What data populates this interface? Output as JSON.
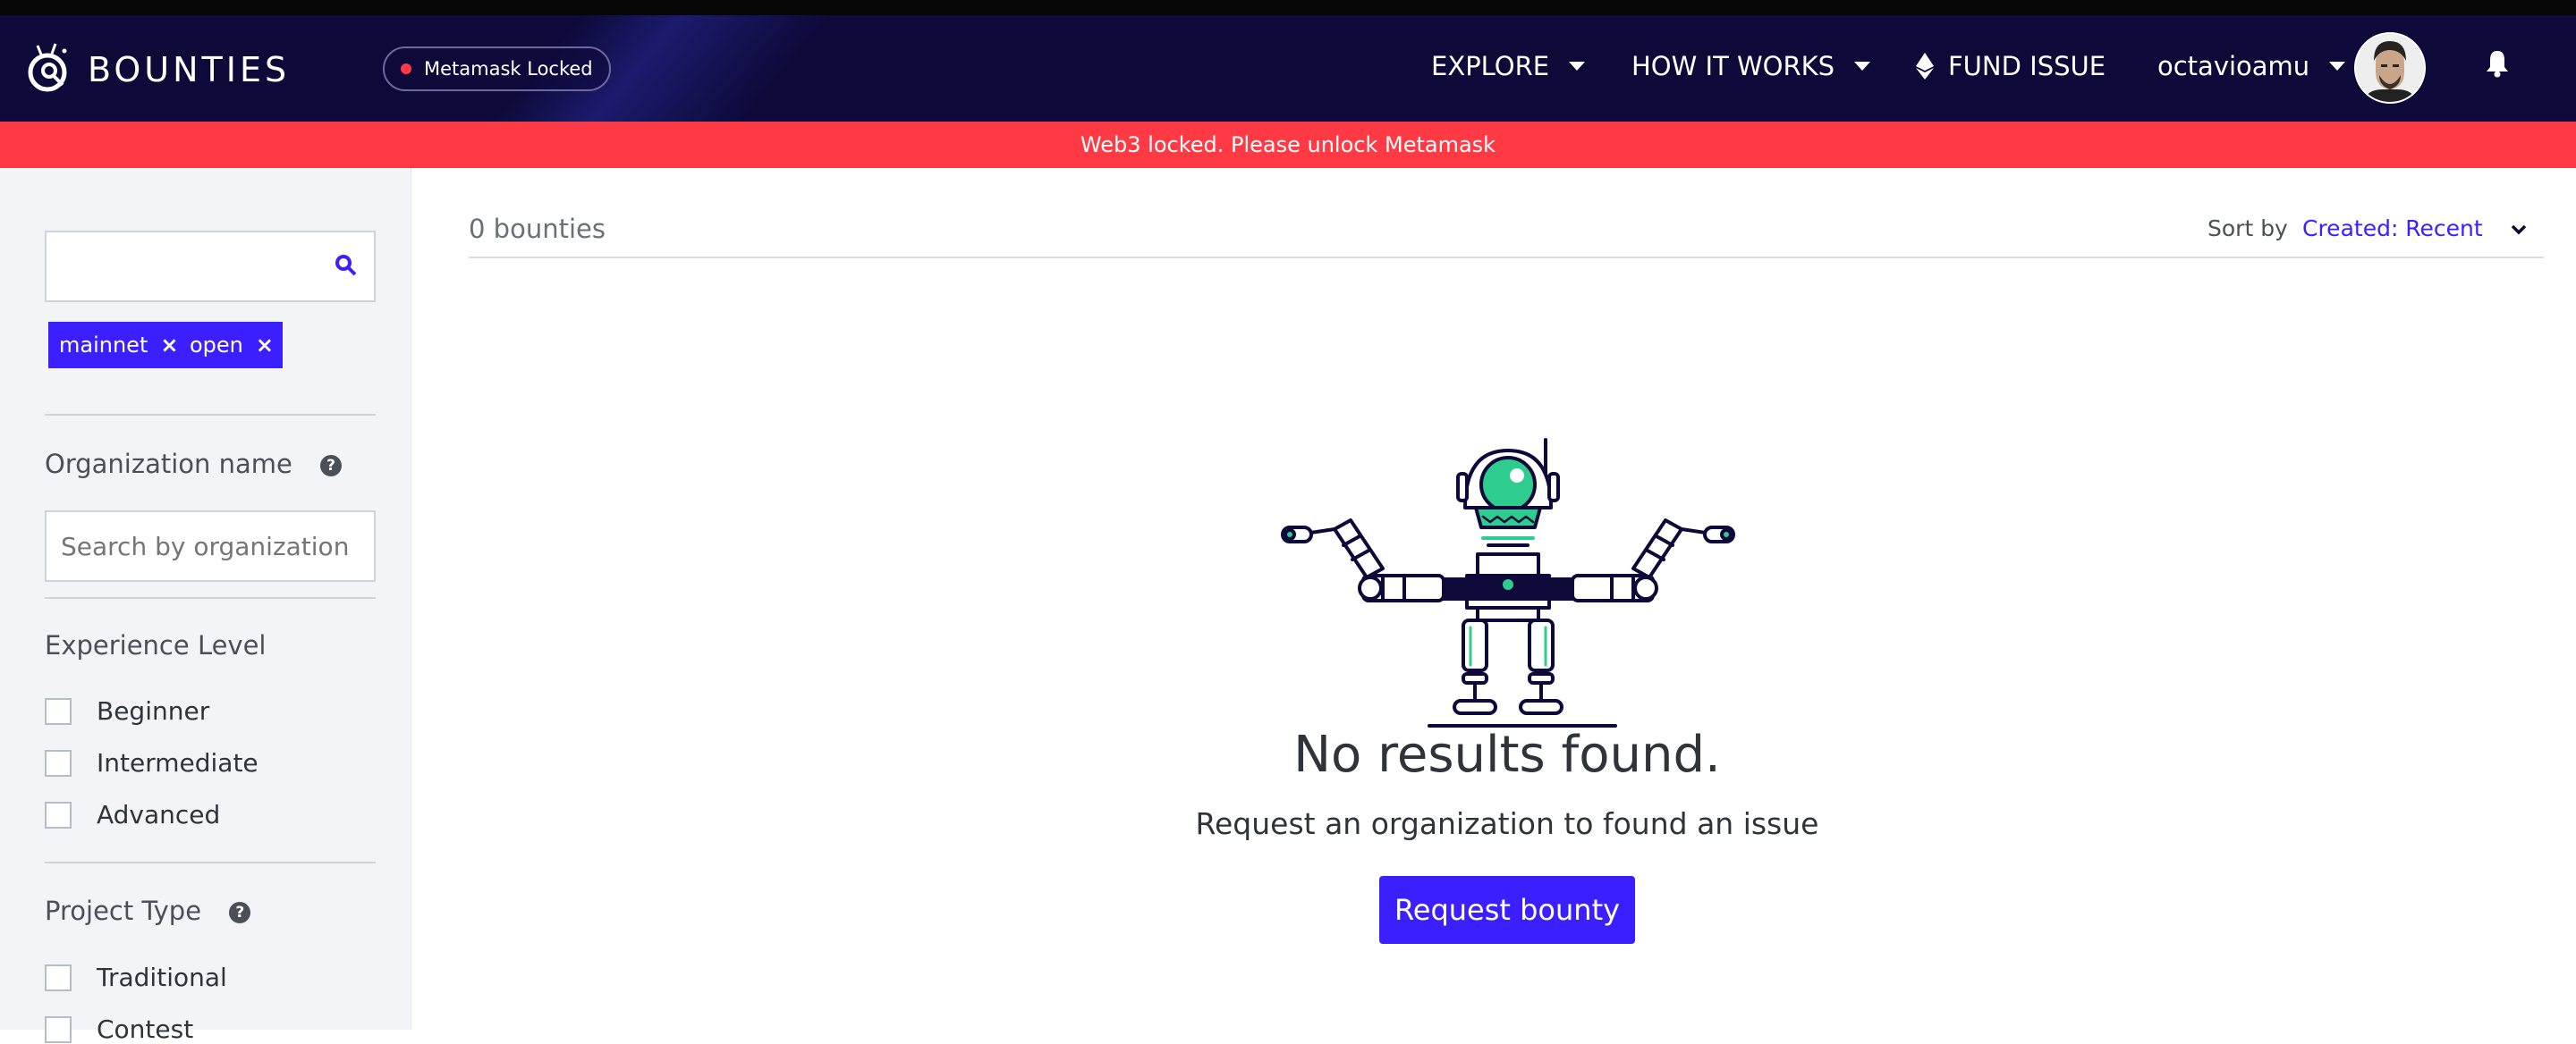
{
  "header": {
    "logo_text": "BOUNTIES",
    "metamask_status": "Metamask Locked",
    "nav": {
      "explore": "EXPLORE",
      "how_it_works": "HOW IT WORKS",
      "fund_issue": "FUND ISSUE",
      "username": "octavioamu"
    }
  },
  "alert": {
    "message": "Web3 locked. Please unlock Metamask"
  },
  "sidebar": {
    "search_value": "",
    "chips": [
      {
        "label": "mainnet"
      },
      {
        "label": "open"
      }
    ],
    "organization": {
      "label": "Organization name",
      "placeholder": "Search by organization"
    },
    "experience": {
      "label": "Experience Level",
      "options": [
        "Beginner",
        "Intermediate",
        "Advanced"
      ]
    },
    "project_type": {
      "label": "Project Type",
      "options": [
        "Traditional",
        "Contest"
      ]
    }
  },
  "main": {
    "count_text": "0 bounties",
    "sort_label": "Sort by",
    "sort_value": "Created: Recent",
    "empty_title": "No results found.",
    "empty_subtitle": "Request an organization to found an issue",
    "request_button": "Request bounty"
  },
  "colors": {
    "navbar": "#0d0a3a",
    "alert": "#ff3a44",
    "accent": "#3b1fff",
    "sidebar": "#f2f4f7",
    "robot_green": "#2ecc8f"
  },
  "icons": {
    "logo": "bounties-logo-icon",
    "status_dot": "red-dot-icon",
    "ethereum": "ethereum-icon",
    "bell": "bell-icon",
    "search": "search-icon",
    "help": "question-circle-icon",
    "chevron": "chevron-down-icon",
    "remove": "close-icon"
  }
}
